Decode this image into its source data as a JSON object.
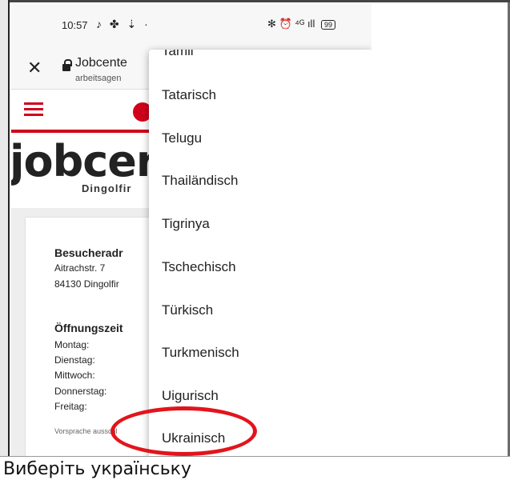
{
  "status": {
    "time": "10:57",
    "left_icons": "♪ ✤ ⇣ ·",
    "right_icons": "✻ ⏰ ⁴ᴳ ıll",
    "battery": "99"
  },
  "browser": {
    "title": "Jobcente",
    "url": "arbeitsagen"
  },
  "site": {
    "logo": "jobcer",
    "subtitle": "Dingolfir"
  },
  "card": {
    "visitor_heading": "Besucheradr",
    "street": "Aitrachstr. 7",
    "city": "84130 Dingolfir",
    "hours_heading": "Öffnungszeit",
    "days": [
      "Montag:",
      "Dienstag:",
      "Mittwoch:",
      "Donnerstag:",
      "Freitag:"
    ],
    "note": "Vorsprache ausschl"
  },
  "dropdown": {
    "options": [
      "Tamil",
      "Tatarisch",
      "Telugu",
      "Thailändisch",
      "Tigrinya",
      "Tschechisch",
      "Türkisch",
      "Turkmenisch",
      "Uigurisch",
      "Ukrainisch"
    ]
  },
  "caption": "Виберіть українську",
  "colors": {
    "accent_red": "#d0021b",
    "highlight_red": "#e3141b"
  }
}
